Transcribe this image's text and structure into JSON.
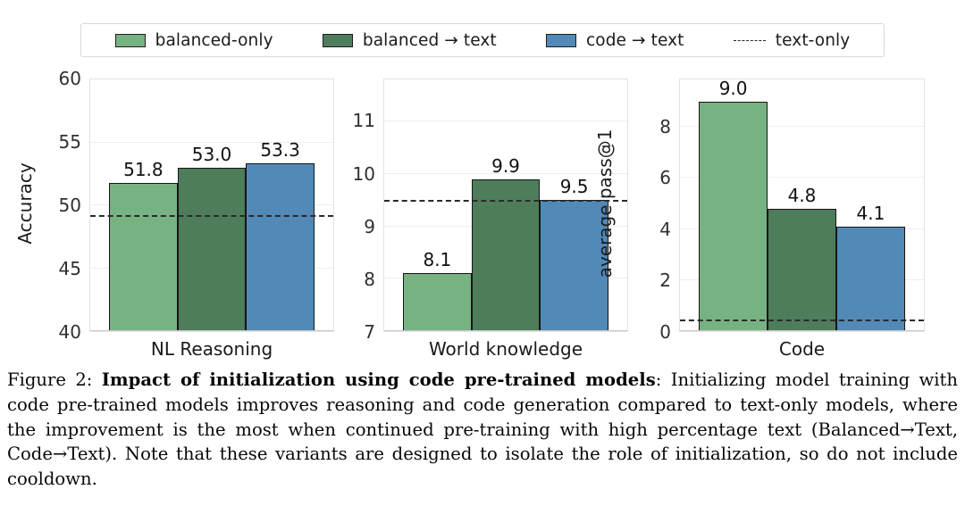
{
  "legend": {
    "entries": [
      {
        "label": "balanced-only",
        "type": "swatch",
        "color": "#77b282"
      },
      {
        "label": "balanced → text",
        "type": "swatch",
        "color": "#4d7d5a"
      },
      {
        "label": "code → text",
        "type": "swatch",
        "color": "#5289b6"
      },
      {
        "label": "text-only",
        "type": "dashed",
        "color": "#262626"
      }
    ]
  },
  "caption": {
    "figure_number": "Figure 2:",
    "bold_title": "Impact of initialization using code pre-trained models",
    "body": ": Initializing model training with code pre-trained models improves reasoning and code generation compared to text-only models, where the improvement is the most when continued pre-training with high percentage text (Balanced→Text, Code→Text). Note that these variants are designed to isolate the role of initialization, so do not include cooldown."
  },
  "chart_data": [
    {
      "type": "bar",
      "title": "",
      "xlabel": "NL Reasoning",
      "ylabel": "Accuracy",
      "categories": [
        "balanced-only",
        "balanced → text",
        "code → text"
      ],
      "values": [
        51.8,
        53.0,
        53.3
      ],
      "value_labels": [
        "51.8",
        "53.0",
        "53.3"
      ],
      "colors": [
        "#77b282",
        "#4d7d5a",
        "#5289b6"
      ],
      "ylim": [
        40,
        60
      ],
      "yticks": [
        40,
        45,
        50,
        55,
        60
      ],
      "ytick_labels": [
        "40",
        "45",
        "50",
        "55",
        "60"
      ],
      "reference_line": {
        "label": "text-only",
        "value": 49.1
      },
      "grid": true,
      "legend_position": "top"
    },
    {
      "type": "bar",
      "title": "",
      "xlabel": "World knowledge",
      "ylabel": "",
      "categories": [
        "balanced-only",
        "balanced → text",
        "code → text"
      ],
      "values": [
        8.1,
        9.9,
        9.5
      ],
      "value_labels": [
        "8.1",
        "9.9",
        "9.5"
      ],
      "colors": [
        "#77b282",
        "#4d7d5a",
        "#5289b6"
      ],
      "ylim": [
        7,
        11.8
      ],
      "yticks": [
        7,
        8,
        9,
        10,
        11
      ],
      "ytick_labels": [
        "7",
        "8",
        "9",
        "10",
        "11"
      ],
      "reference_line": {
        "label": "text-only",
        "value": 9.47
      },
      "grid": true,
      "legend_position": "top"
    },
    {
      "type": "bar",
      "title": "",
      "xlabel": "Code",
      "ylabel": "average pass@1",
      "categories": [
        "balanced-only",
        "balanced → text",
        "code → text"
      ],
      "values": [
        9.0,
        4.8,
        4.1
      ],
      "value_labels": [
        "9.0",
        "4.8",
        "4.1"
      ],
      "colors": [
        "#77b282",
        "#4d7d5a",
        "#5289b6"
      ],
      "ylim": [
        0,
        9.86
      ],
      "yticks": [
        0,
        2,
        4,
        6,
        8
      ],
      "ytick_labels": [
        "0",
        "2",
        "4",
        "6",
        "8"
      ],
      "reference_line": {
        "label": "text-only",
        "value": 0.4
      },
      "grid": true,
      "legend_position": "top"
    }
  ]
}
